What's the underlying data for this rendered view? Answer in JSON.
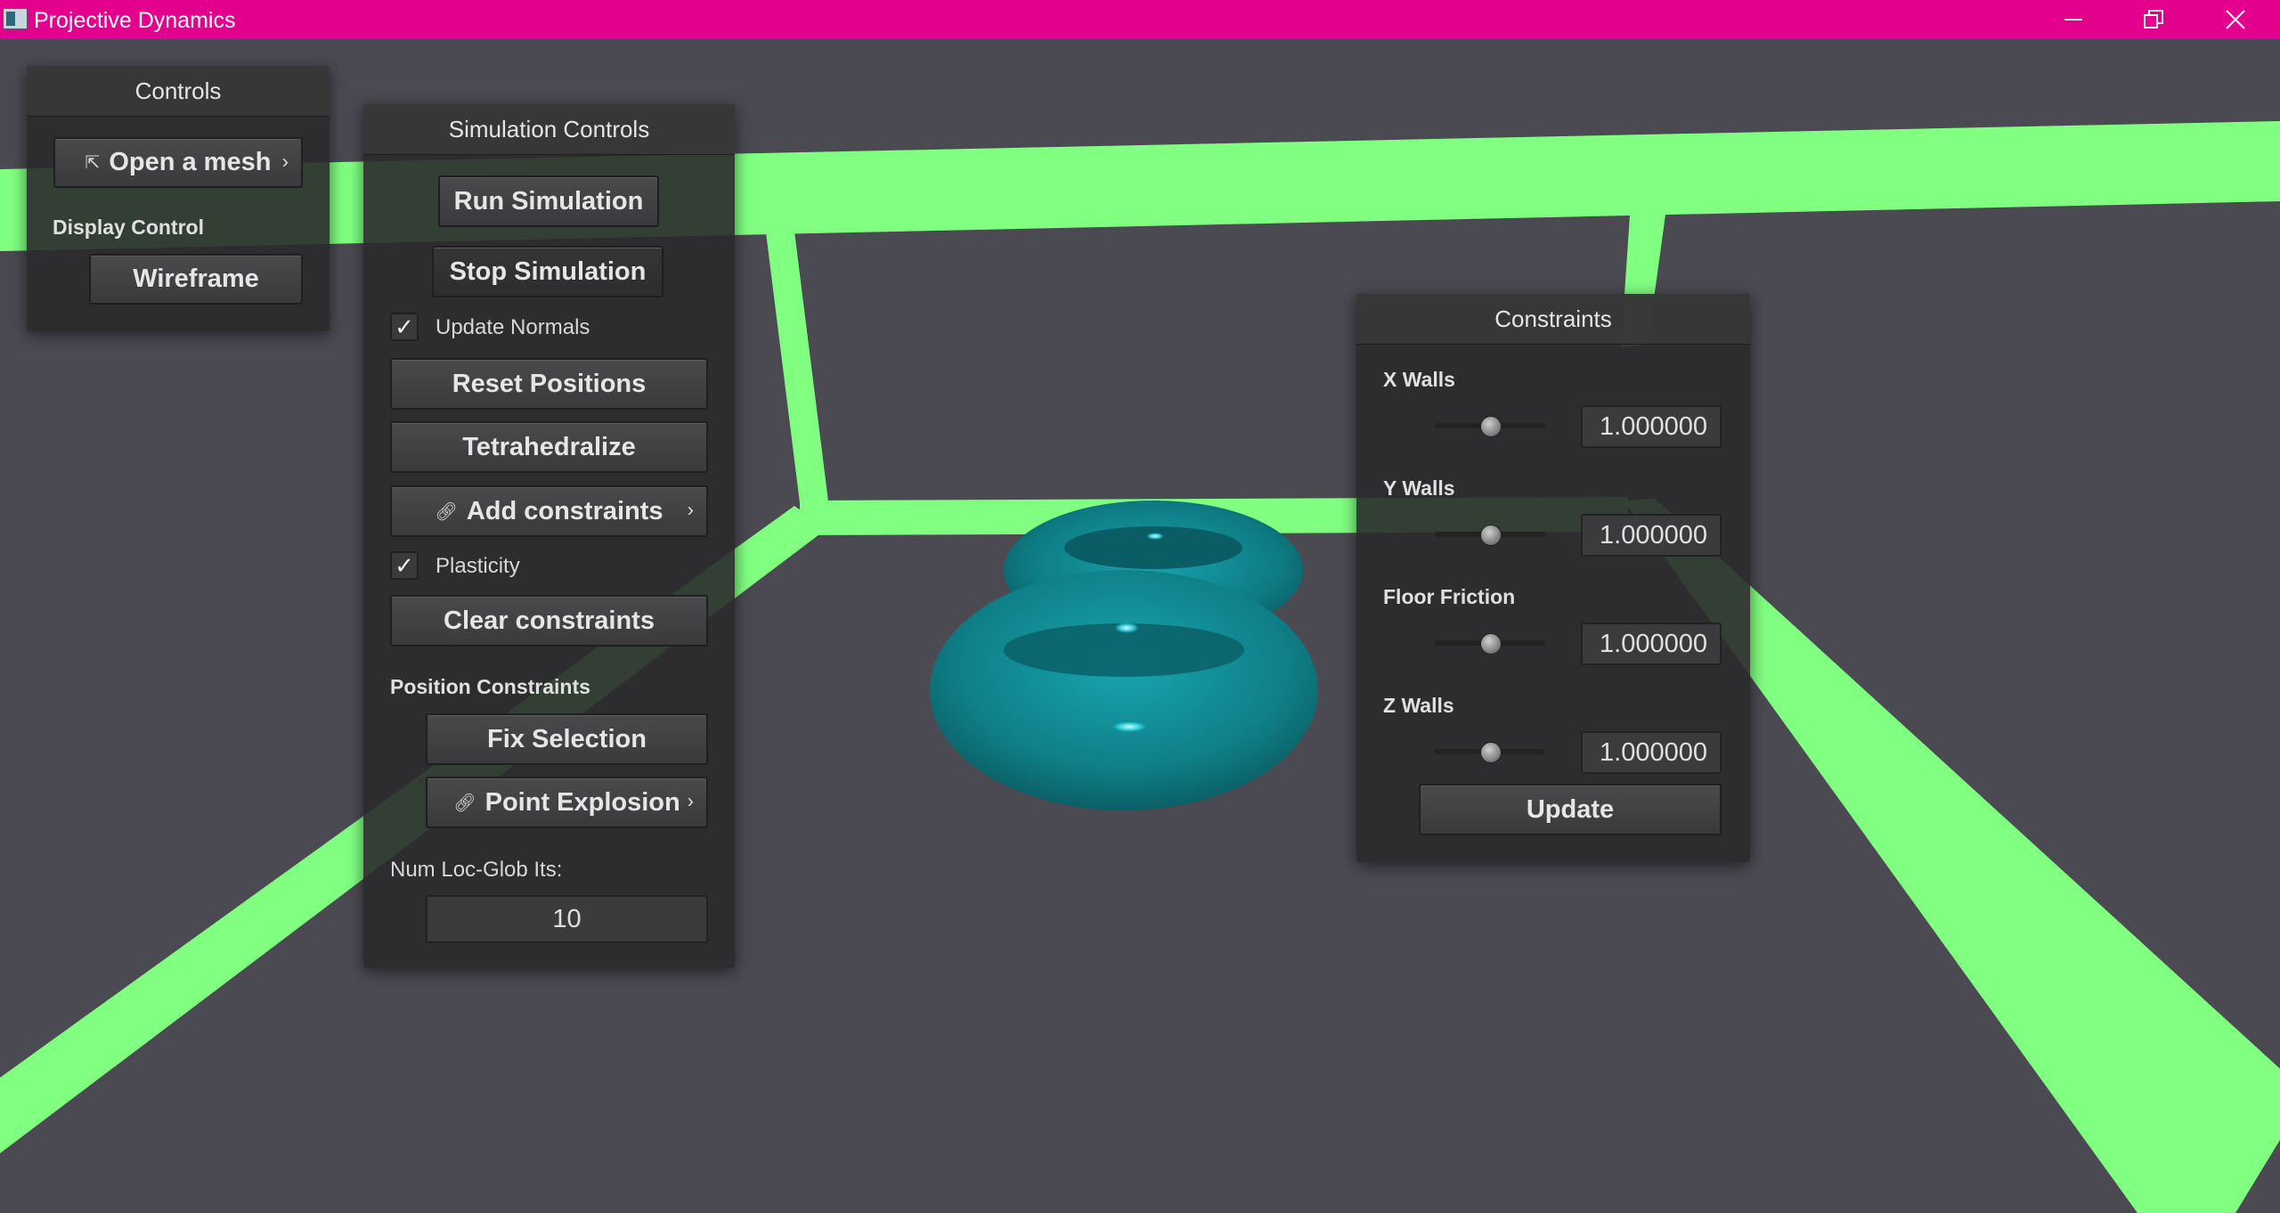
{
  "window": {
    "title": "Projective Dynamics"
  },
  "colors": {
    "titlebar": "#e3008c",
    "floor_grid": "#80ff80",
    "mesh": "#0f8088",
    "background": "#4b4a52"
  },
  "icons": {
    "app": "app-icon",
    "minimize": "minimize-icon",
    "restore": "restore-icon",
    "close": "close-icon"
  },
  "controls_panel": {
    "title": "Controls",
    "open_mesh": {
      "label": "Open a mesh",
      "icon": "export-icon"
    },
    "display_control_label": "Display Control",
    "wireframe_label": "Wireframe"
  },
  "simulation_panel": {
    "title": "Simulation Controls",
    "run_label": "Run Simulation",
    "stop_label": "Stop Simulation",
    "update_normals": {
      "label": "Update Normals",
      "checked": true
    },
    "reset_label": "Reset Positions",
    "tetra_label": "Tetrahedralize",
    "add_constraints": {
      "label": "Add constraints",
      "icon": "link-icon"
    },
    "plasticity": {
      "label": "Plasticity",
      "checked": true
    },
    "clear_label": "Clear constraints",
    "position_constraints_label": "Position Constraints",
    "fix_selection_label": "Fix Selection",
    "point_explosion": {
      "label": "Point Explosion",
      "icon": "link-icon"
    },
    "num_its_label": "Num Loc-Glob Its:",
    "num_its_value": "10"
  },
  "constraints_panel": {
    "title": "Constraints",
    "rows": [
      {
        "label": "X Walls",
        "value": "1.000000",
        "slider_fraction": 0.5
      },
      {
        "label": "Y Walls",
        "value": "1.000000",
        "slider_fraction": 0.5
      },
      {
        "label": "Floor Friction",
        "value": "1.000000",
        "slider_fraction": 0.5
      },
      {
        "label": "Z Walls",
        "value": "1.000000",
        "slider_fraction": 0.5
      }
    ],
    "update_label": "Update"
  }
}
